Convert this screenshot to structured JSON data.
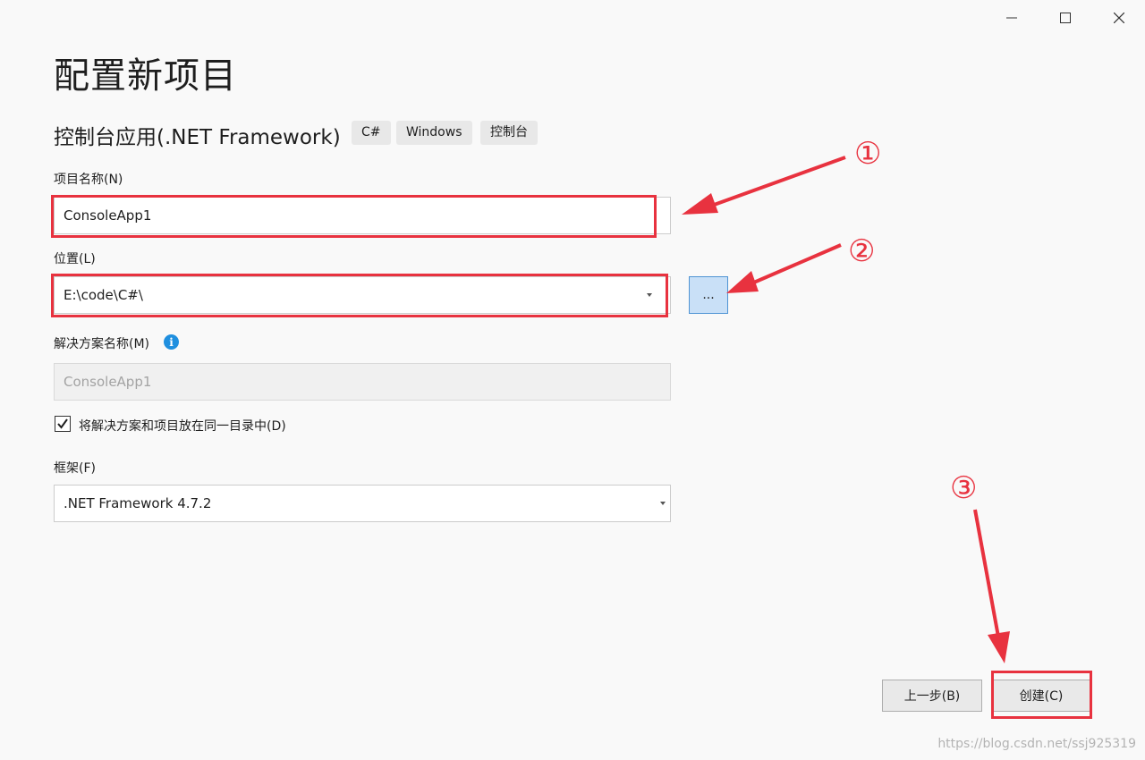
{
  "window": {
    "title": "配置新项目",
    "controls": {
      "minimize": "minimize-icon",
      "maximize": "maximize-icon",
      "close": "close-icon"
    }
  },
  "template": {
    "name": "控制台应用(.NET Framework)",
    "tags": [
      "C#",
      "Windows",
      "控制台"
    ]
  },
  "form": {
    "project_name": {
      "label": "项目名称(N)",
      "value": "ConsoleApp1"
    },
    "location": {
      "label": "位置(L)",
      "value": "E:\\code\\C#\\",
      "browse_label": "..."
    },
    "solution_name": {
      "label": "解决方案名称(M)",
      "value": "ConsoleApp1",
      "info_icon": "i"
    },
    "same_directory": {
      "label": "将解决方案和项目放在同一目录中(D)",
      "checked": true
    },
    "framework": {
      "label": "框架(F)",
      "value": ".NET Framework 4.7.2"
    }
  },
  "footer": {
    "back_label": "上一步(B)",
    "create_label": "创建(C)"
  },
  "annotations": {
    "marker_1": "①",
    "marker_2": "②",
    "marker_3": "③",
    "color": "#e8323f"
  },
  "watermark": "https://blog.csdn.net/ssj925319"
}
